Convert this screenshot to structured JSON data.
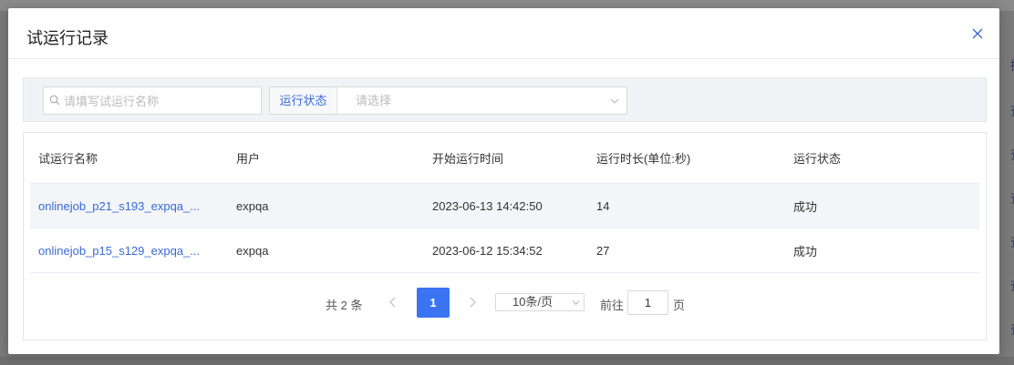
{
  "dialog": {
    "title": "试运行记录"
  },
  "filter": {
    "search_placeholder": "请填写试运行名称",
    "search_value": "",
    "status_label": "运行状态",
    "status_placeholder": "请选择"
  },
  "table": {
    "headers": [
      "试运行名称",
      "用户",
      "开始运行时间",
      "运行时长(单位:秒)",
      "运行状态"
    ],
    "rows": [
      {
        "name": "onlinejob_p21_s193_expqa_...",
        "user": "expqa",
        "start": "2023-06-13 14:42:50",
        "duration": "14",
        "status": "成功"
      },
      {
        "name": "onlinejob_p15_s129_expqa_...",
        "user": "expqa",
        "start": "2023-06-12 15:34:52",
        "duration": "27",
        "status": "成功"
      }
    ]
  },
  "pagination": {
    "total_text": "共 2 条",
    "current_page": "1",
    "page_size": "10条/页",
    "goto_label": "前往",
    "goto_value": "1",
    "page_unit": "页"
  },
  "colors": {
    "accent": "#3b74f0",
    "link": "#3a6ad4"
  },
  "background": {
    "right_edge_chars": [
      "操",
      "查",
      "查",
      "查",
      "查",
      "查",
      "查"
    ]
  }
}
